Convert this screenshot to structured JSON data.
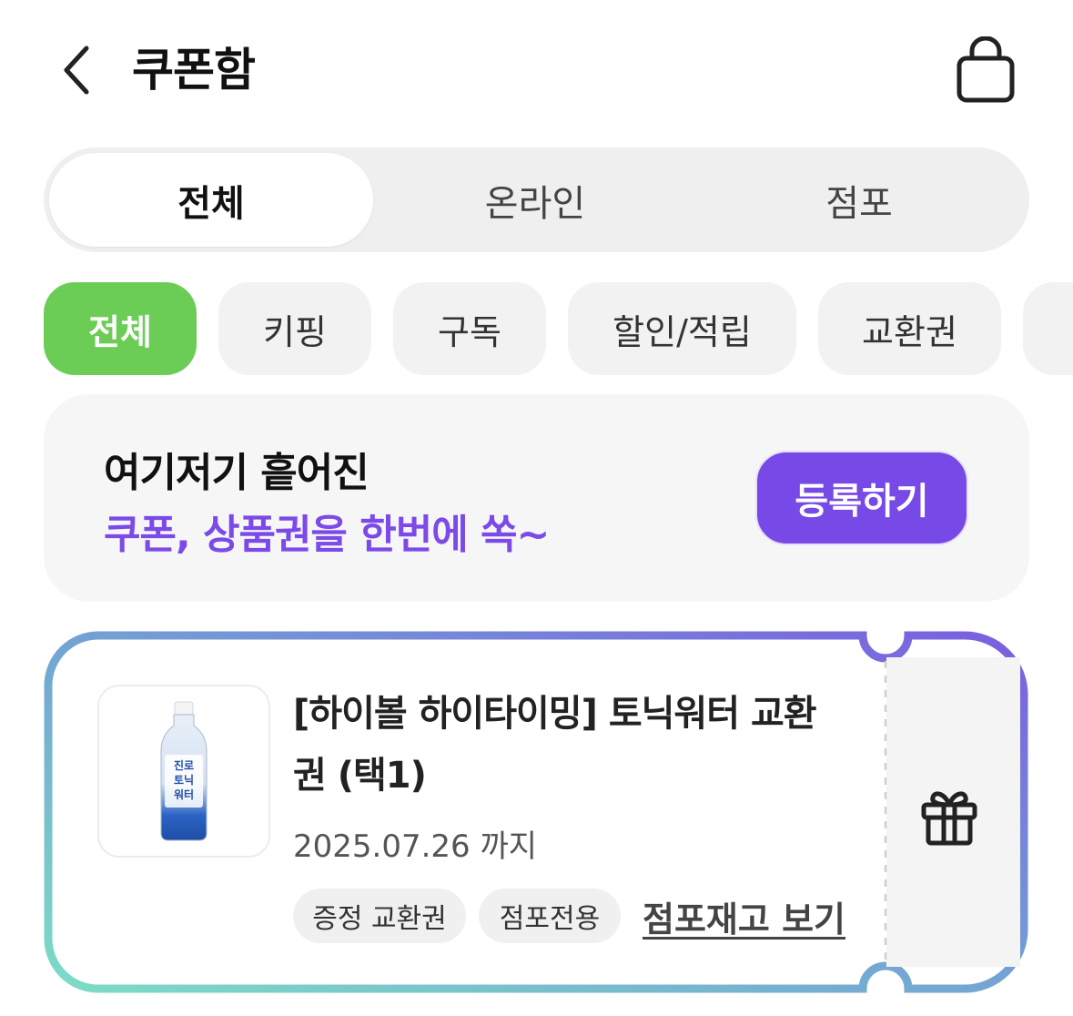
{
  "header": {
    "title": "쿠폰함",
    "back_icon": "chevron-left-icon",
    "bag_icon": "shopping-bag-icon"
  },
  "segments": [
    {
      "label": "전체",
      "active": true
    },
    {
      "label": "온라인",
      "active": false
    },
    {
      "label": "점포",
      "active": false
    }
  ],
  "chips": [
    {
      "label": "전체",
      "active": true
    },
    {
      "label": "키핑",
      "active": false
    },
    {
      "label": "구독",
      "active": false
    },
    {
      "label": "할인/적립",
      "active": false
    },
    {
      "label": "교환권",
      "active": false
    }
  ],
  "promo": {
    "line1": "여기저기 흩어진",
    "line2": "쿠폰, 상품권을 한번에 쏙~",
    "button": "등록하기"
  },
  "coupon": {
    "title": "[하이볼 하이타이밍] 토닉워터 교환권 (택1)",
    "expiry": "2025.07.26 까지",
    "tags": [
      "증정 교환권",
      "점포전용"
    ],
    "stock_link": "점포재고 보기",
    "product_label": "진로 토닉 워터",
    "gift_icon": "gift-icon"
  },
  "colors": {
    "accent_green": "#6ccd56",
    "accent_purple": "#7749e6",
    "gradient_start": "#7ddcc6",
    "gradient_end": "#7a5ee0"
  }
}
